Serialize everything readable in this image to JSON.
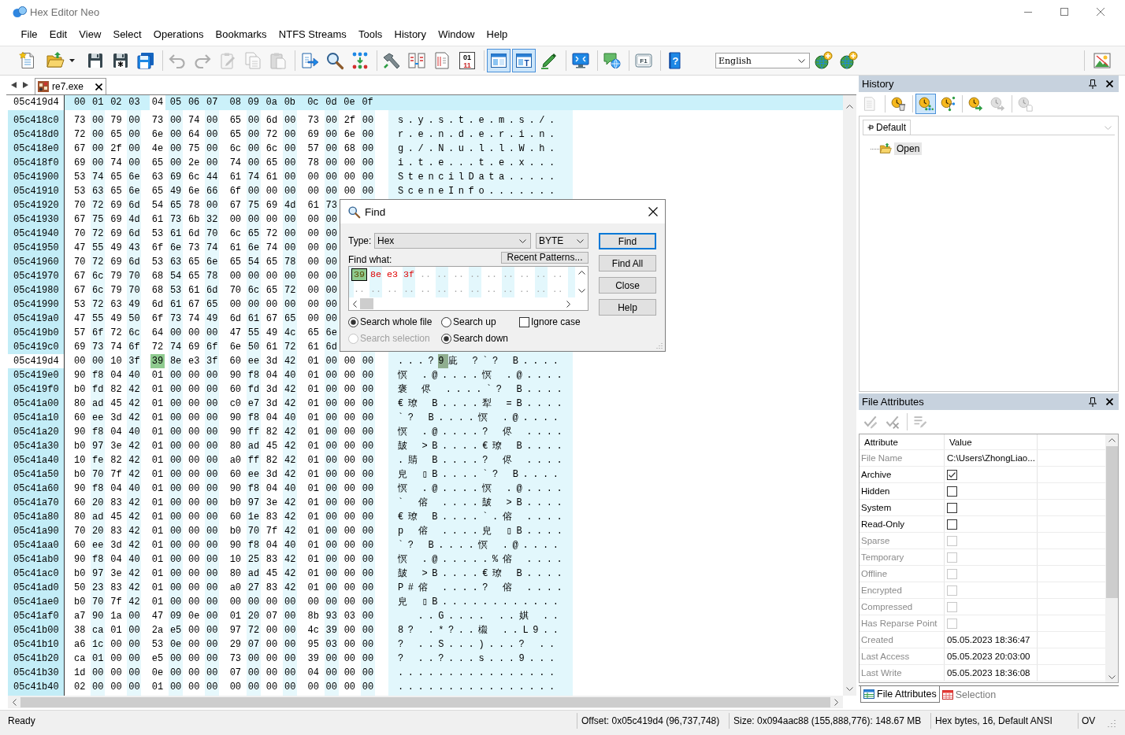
{
  "window": {
    "title": "Hex Editor Neo"
  },
  "menu": [
    "File",
    "Edit",
    "View",
    "Select",
    "Operations",
    "Bookmarks",
    "NTFS Streams",
    "Tools",
    "History",
    "Window",
    "Help"
  ],
  "toolbar": {
    "groups": [
      [
        {
          "kind": "new",
          "disabled": false,
          "pressed": false
        },
        {
          "kind": "open",
          "disabled": false,
          "pressed": false
        },
        {
          "kind": "save",
          "disabled": false,
          "pressed": false
        },
        {
          "kind": "save-copy",
          "disabled": false,
          "pressed": false
        },
        {
          "kind": "save-all",
          "disabled": false,
          "pressed": false
        }
      ],
      [
        {
          "kind": "undo",
          "disabled": true,
          "pressed": false
        },
        {
          "kind": "redo",
          "disabled": true,
          "pressed": false
        },
        {
          "kind": "edit",
          "disabled": true,
          "pressed": false
        },
        {
          "kind": "copy",
          "disabled": true,
          "pressed": false
        },
        {
          "kind": "paste",
          "disabled": true,
          "pressed": false
        }
      ],
      [
        {
          "kind": "export",
          "disabled": false,
          "pressed": false
        },
        {
          "kind": "find",
          "disabled": false,
          "pressed": false
        },
        {
          "kind": "dots",
          "disabled": false,
          "pressed": false
        }
      ],
      [
        {
          "kind": "hammer",
          "disabled": false,
          "pressed": false
        },
        {
          "kind": "compare",
          "disabled": false,
          "pressed": false
        },
        {
          "kind": "document",
          "disabled": false,
          "pressed": false
        },
        {
          "kind": "binary",
          "text": [
            "01",
            "11"
          ],
          "disabled": false,
          "pressed": false
        }
      ],
      [
        {
          "kind": "window",
          "disabled": false,
          "pressed": true
        },
        {
          "kind": "window-text",
          "text": [
            "T"
          ],
          "disabled": false,
          "pressed": true
        },
        {
          "kind": "pencil",
          "disabled": false,
          "pressed": false
        }
      ],
      [
        {
          "kind": "monitor",
          "disabled": false,
          "pressed": false
        }
      ],
      [
        {
          "kind": "chat",
          "disabled": false,
          "pressed": false
        }
      ],
      [
        {
          "kind": "key",
          "text": [
            "F1"
          ],
          "disabled": false,
          "pressed": false
        }
      ],
      [
        {
          "kind": "help",
          "text": [
            "?"
          ],
          "disabled": false,
          "pressed": false
        }
      ]
    ],
    "language": "English",
    "extra": [
      {
        "kind": "globe-add",
        "disabled": false,
        "pressed": false
      },
      {
        "kind": "globe-add",
        "disabled": false,
        "pressed": false
      }
    ],
    "end": [
      {
        "kind": "picture",
        "disabled": false,
        "pressed": false
      }
    ]
  },
  "editor": {
    "tabs": [
      {
        "label": "re7.exe",
        "selected": true
      }
    ],
    "header": {
      "offset": "05c419d4",
      "columns": [
        {
          "label": "00",
          "selected": false
        },
        {
          "label": "01",
          "selected": false
        },
        {
          "label": "02",
          "selected": false
        },
        {
          "label": "03",
          "selected": false
        },
        {
          "label": "04",
          "selected": true
        },
        {
          "label": "05",
          "selected": false
        },
        {
          "label": "06",
          "selected": false
        },
        {
          "label": "07",
          "selected": false
        },
        {
          "label": "08",
          "selected": false
        },
        {
          "label": "09",
          "selected": false
        },
        {
          "label": "0a",
          "selected": false
        },
        {
          "label": "0b",
          "selected": false
        },
        {
          "label": "0c",
          "selected": false
        },
        {
          "label": "0d",
          "selected": false
        },
        {
          "label": "0e",
          "selected": false
        },
        {
          "label": "0f",
          "selected": false
        }
      ]
    },
    "rows": [
      {
        "offset": "05c418c0",
        "selected": false,
        "hex": [
          "73 00 79 00",
          "73 00 74 00",
          "65 00 6d 00",
          "73 00 2f 00"
        ],
        "ascii": "s.y.s.t.e.m.s./."
      },
      {
        "offset": "05c418d0",
        "selected": false,
        "hex": [
          "72 00 65 00",
          "6e 00 64 00",
          "65 00 72 00",
          "69 00 6e 00"
        ],
        "ascii": "r.e.n.d.e.r.i.n."
      },
      {
        "offset": "05c418e0",
        "selected": false,
        "hex": [
          "67 00 2f 00",
          "4e 00 75 00",
          "6c 00 6c 00",
          "57 00 68 00"
        ],
        "ascii": "g./.N.u.l.l.W.h."
      },
      {
        "offset": "05c418f0",
        "selected": false,
        "hex": [
          "69 00 74 00",
          "65 00 2e 00",
          "74 00 65 00",
          "78 00 00 00"
        ],
        "ascii": "i.t.e...t.e.x..."
      },
      {
        "offset": "05c41900",
        "selected": false,
        "hex": [
          "53 74 65 6e",
          "63 69 6c 44",
          "61 74 61 00",
          "00 00 00 00"
        ],
        "ascii": "StencilData....."
      },
      {
        "offset": "05c41910",
        "selected": false,
        "hex": [
          "53 63 65 6e",
          "65 49 6e 66",
          "6f 00 00 00",
          "00 00 00 00"
        ],
        "ascii": "SceneInfo......."
      },
      {
        "offset": "05c41920",
        "selected": false,
        "hex": [
          "70 72 69 6d",
          "54 65 78 00",
          "67 75 69 4d",
          "61 73"
        ]
      },
      {
        "offset": "05c41930",
        "selected": false,
        "hex": [
          "67 75 69 4d",
          "61 73 6b 32",
          "00 00 00 00",
          "00 00"
        ]
      },
      {
        "offset": "05c41940",
        "selected": false,
        "hex": [
          "70 72 69 6d",
          "53 61 6d 70",
          "6c 65 72 00",
          "00 00"
        ]
      },
      {
        "offset": "05c41950",
        "selected": false,
        "hex": [
          "47 55 49 43",
          "6f 6e 73 74",
          "61 6e 74 00",
          "00 00"
        ]
      },
      {
        "offset": "05c41960",
        "selected": false,
        "hex": [
          "70 72 69 6d",
          "53 63 65 6e",
          "65 54 65 78",
          "00 00"
        ]
      },
      {
        "offset": "05c41970",
        "selected": false,
        "hex": [
          "67 6c 79 70",
          "68 54 65 78",
          "00 00 00 00",
          "00 00"
        ]
      },
      {
        "offset": "05c41980",
        "selected": false,
        "hex": [
          "67 6c 79 70",
          "68 53 61 6d",
          "70 6c 65 72",
          "00 00"
        ]
      },
      {
        "offset": "05c41990",
        "selected": false,
        "hex": [
          "53 72 63 49",
          "6d 61 67 65",
          "00 00 00 00",
          "00 00"
        ]
      },
      {
        "offset": "05c419a0",
        "selected": false,
        "hex": [
          "47 55 49 50",
          "6f 73 74 49",
          "6d 61 67 65",
          "00 00"
        ]
      },
      {
        "offset": "05c419b0",
        "selected": false,
        "hex": [
          "57 6f 72 6c",
          "64 00 00 00",
          "47 55 49 4c",
          "65 6e"
        ]
      },
      {
        "offset": "05c419c0",
        "selected": false,
        "hex": [
          "69 73 74 6f",
          "72 74 69 6f",
          "6e 50 61 72",
          "61 6d"
        ]
      },
      {
        "offset": "05c419d4",
        "selected": true,
        "hex": [
          "00 00 10 3f"
        ],
        "caret": {
          "hex": "39",
          "ascii": "9"
        },
        "hex_after": [
          "8e e3 3f",
          "60 ee 3d 42",
          "01 00 00 00"
        ],
        "ascii": "...?",
        "ascii_after": "庛 ?`? B...."
      },
      {
        "offset": "05c419e0",
        "selected": false,
        "hex": [
          "90 f8 04 40",
          "01 00 00 00",
          "90 f8 04 40",
          "01 00 00 00"
        ],
        "ascii": "慏 .@....慏 .@...."
      },
      {
        "offset": "05c419f0",
        "selected": false,
        "hex": [
          "b0 fd 82 42",
          "01 00 00 00",
          "60 fd 3d 42",
          "01 00 00 00"
        ],
        "ascii": "褒 侭 ....`? B...."
      },
      {
        "offset": "05c41a00",
        "selected": false,
        "hex": [
          "80 ad 45 42",
          "01 00 00 00",
          "c0 e7 3d 42",
          "01 00 00 00"
        ],
        "ascii": "€璙 B....犁 =B...."
      },
      {
        "offset": "05c41a10",
        "selected": false,
        "hex": [
          "60 ee 3d 42",
          "01 00 00 00",
          "90 f8 04 40",
          "01 00 00 00"
        ],
        "ascii": "`? B....慏 .@...."
      },
      {
        "offset": "05c41a20",
        "selected": false,
        "hex": [
          "90 f8 04 40",
          "01 00 00 00",
          "90 ff 82 42",
          "01 00 00 00"
        ],
        "ascii": "慏 .@....? 侭 ...."
      },
      {
        "offset": "05c41a30",
        "selected": false,
        "hex": [
          "b0 97 3e 42",
          "01 00 00 00",
          "80 ad 45 42",
          "01 00 00 00"
        ],
        "ascii": "皷 >B....€璙 B...."
      },
      {
        "offset": "05c41a40",
        "selected": false,
        "hex": [
          "10 fe 82 42",
          "01 00 00 00",
          "a0 ff 82 42",
          "01 00 00 00"
        ],
        "ascii": ".䝼 B....? 侭 ...."
      },
      {
        "offset": "05c41a50",
        "selected": false,
        "hex": [
          "b0 70 7f 42",
          "01 00 00 00",
          "60 ee 3d 42",
          "01 00 00 00"
        ],
        "ascii": "皃 ▯B....`? B...."
      },
      {
        "offset": "05c41a60",
        "selected": false,
        "hex": [
          "90 f8 04 40",
          "01 00 00 00",
          "90 f8 04 40",
          "01 00 00 00"
        ],
        "ascii": "慏 .@....慏 .@...."
      },
      {
        "offset": "05c41a70",
        "selected": false,
        "hex": [
          "60 20 83 42",
          "01 00 00 00",
          "b0 97 3e 42",
          "01 00 00 00"
        ],
        "ascii": "` 傛 ....皷 >B...."
      },
      {
        "offset": "05c41a80",
        "selected": false,
        "hex": [
          "80 ad 45 42",
          "01 00 00 00",
          "60 1e 83 42",
          "01 00 00 00"
        ],
        "ascii": "€璙 B....`.傛 ...."
      },
      {
        "offset": "05c41a90",
        "selected": false,
        "hex": [
          "70 20 83 42",
          "01 00 00 00",
          "b0 70 7f 42",
          "01 00 00 00"
        ],
        "ascii": "p 傛 ....皃 ▯B...."
      },
      {
        "offset": "05c41aa0",
        "selected": false,
        "hex": [
          "60 ee 3d 42",
          "01 00 00 00",
          "90 f8 04 40",
          "01 00 00 00"
        ],
        "ascii": "`? B....慏 .@...."
      },
      {
        "offset": "05c41ab0",
        "selected": false,
        "hex": [
          "90 f8 04 40",
          "01 00 00 00",
          "10 25 83 42",
          "01 00 00 00"
        ],
        "ascii": "慏 .@.....%傛 ...."
      },
      {
        "offset": "05c41ac0",
        "selected": false,
        "hex": [
          "b0 97 3e 42",
          "01 00 00 00",
          "80 ad 45 42",
          "01 00 00 00"
        ],
        "ascii": "皷 >B....€璙 B...."
      },
      {
        "offset": "05c41ad0",
        "selected": false,
        "hex": [
          "50 23 83 42",
          "01 00 00 00",
          "a0 27 83 42",
          "01 00 00 00"
        ],
        "ascii": "P#傛 ....? 傛 ...."
      },
      {
        "offset": "05c41ae0",
        "selected": false,
        "hex": [
          "b0 70 7f 42",
          "01 00 00 00",
          "00 00 00 00",
          "00 00 00 00"
        ],
        "ascii": "皃 ▯B............"
      },
      {
        "offset": "05c41af0",
        "selected": false,
        "hex": [
          "a7 90 1a 00",
          "47 09 0e 00",
          "01 20 07 00",
          "8b 93 03 00"
        ],
        "ascii": "  ..G.... ..娸 .."
      },
      {
        "offset": "05c41b00",
        "selected": false,
        "hex": [
          "38 ca 01 00",
          "2a e5 00 00",
          "97 72 00 00",
          "4c 39 00 00"
        ],
        "ascii": "8? .*?..榝 ..L9.."
      },
      {
        "offset": "05c41b10",
        "selected": false,
        "hex": [
          "a6 1c 00 00",
          "53 0e 00 00",
          "29 07 00 00",
          "95 03 00 00"
        ],
        "ascii": "? ..S...)...? .."
      },
      {
        "offset": "05c41b20",
        "selected": false,
        "hex": [
          "ca 01 00 00",
          "e5 00 00 00",
          "73 00 00 00",
          "39 00 00 00"
        ],
        "ascii": "? ..?...s...9..."
      },
      {
        "offset": "05c41b30",
        "selected": false,
        "hex": [
          "1d 00 00 00",
          "0e 00 00 00",
          "07 00 00 00",
          "04 00 00 00"
        ],
        "ascii": "................"
      },
      {
        "offset": "05c41b40",
        "selected": false,
        "hex": [
          "02 00 00 00",
          "01 00 00 00",
          "00 00 00 00",
          "00 00 00 00"
        ],
        "ascii": "................"
      }
    ]
  },
  "find_dialog": {
    "title": "Find",
    "type_label": "Type:",
    "type_value": "Hex",
    "unit_value": "BYTE",
    "find_what_label": "Find what:",
    "recent_button": "Recent Patterns...",
    "pattern": {
      "caret": "39",
      "entered": "8e e3 3f",
      "empty": [
        ".. .. .. .. .. .. .. .. ..",
        ".. .. .. .. .. .. .. .. .. .. .. .. .."
      ]
    },
    "options": [
      {
        "kind": "radio",
        "label": "Search whole file",
        "checked": true,
        "disabled": false
      },
      {
        "kind": "radio",
        "label": "Search up",
        "checked": false,
        "disabled": false
      },
      {
        "kind": "checkbox",
        "label": "Ignore case",
        "checked": false,
        "disabled": false
      },
      {
        "kind": "radio",
        "label": "Search selection",
        "checked": false,
        "disabled": true
      },
      {
        "kind": "radio",
        "label": "Search down",
        "checked": true,
        "disabled": false
      }
    ],
    "buttons": [
      {
        "label": "Find",
        "default": true
      },
      {
        "label": "Find All",
        "default": false
      },
      {
        "label": "Close",
        "default": false
      },
      {
        "label": "Help",
        "default": false
      }
    ]
  },
  "history": {
    "title": "History",
    "toolbar": [
      [
        {
          "kind": "history-doc",
          "disabled": true,
          "pressed": false
        }
      ],
      [
        {
          "kind": "clock-delete",
          "disabled": false,
          "pressed": false
        }
      ],
      [
        {
          "kind": "clock-dots",
          "disabled": false,
          "pressed": true
        },
        {
          "kind": "clock-branch",
          "disabled": false,
          "pressed": false
        }
      ],
      [
        {
          "kind": "clock-apply",
          "disabled": false,
          "pressed": false
        },
        {
          "kind": "clock-revert",
          "disabled": true,
          "pressed": false
        }
      ],
      [
        {
          "kind": "clock-export",
          "disabled": true,
          "pressed": false
        }
      ]
    ],
    "tabs": [
      {
        "label": "Default",
        "selected": true
      }
    ],
    "tree": [
      {
        "label": "Open",
        "selected": true
      }
    ]
  },
  "file_attributes": {
    "title": "File Attributes",
    "toolbar": [
      [
        {
          "kind": "check-edit",
          "disabled": true
        },
        {
          "kind": "check-delete",
          "disabled": true
        }
      ],
      [
        {
          "kind": "list-edit",
          "disabled": true
        }
      ]
    ],
    "columns": [
      "Attribute",
      "Value"
    ],
    "rows": [
      {
        "kind": "text",
        "name": "File Name",
        "value": "C:\\Users\\ZhongLiao...",
        "disabled": true
      },
      {
        "kind": "checkbox",
        "name": "Archive",
        "checked": true,
        "disabled": false
      },
      {
        "kind": "checkbox",
        "name": "Hidden",
        "checked": false,
        "disabled": false
      },
      {
        "kind": "checkbox",
        "name": "System",
        "checked": false,
        "disabled": false
      },
      {
        "kind": "checkbox",
        "name": "Read-Only",
        "checked": false,
        "disabled": false
      },
      {
        "kind": "checkbox",
        "name": "Sparse",
        "checked": false,
        "disabled": true
      },
      {
        "kind": "checkbox",
        "name": "Temporary",
        "checked": false,
        "disabled": true
      },
      {
        "kind": "checkbox",
        "name": "Offline",
        "checked": false,
        "disabled": true
      },
      {
        "kind": "checkbox",
        "name": "Encrypted",
        "checked": false,
        "disabled": true
      },
      {
        "kind": "checkbox",
        "name": "Compressed",
        "checked": false,
        "disabled": true
      },
      {
        "kind": "checkbox",
        "name": "Has Reparse Point",
        "checked": false,
        "disabled": true
      },
      {
        "kind": "text",
        "name": "Created",
        "value": "05.05.2023 18:36:47",
        "disabled": true
      },
      {
        "kind": "text",
        "name": "Last Access",
        "value": "05.05.2023 20:03:00",
        "disabled": true
      },
      {
        "kind": "text",
        "name": "Last Write",
        "value": "05.05.2023 18:36:08",
        "disabled": true
      }
    ],
    "tabs": [
      {
        "kind": "attributes",
        "label": "File Attributes",
        "selected": true
      },
      {
        "kind": "selection",
        "label": "Selection",
        "selected": false
      }
    ]
  },
  "status_bar": [
    "Ready",
    "Offset: 0x05c419d4 (96,737,748)",
    "Size: 0x094aac88 (155,888,776): 148.67 MB",
    "Hex bytes, 16, Default ANSI",
    "OV"
  ]
}
